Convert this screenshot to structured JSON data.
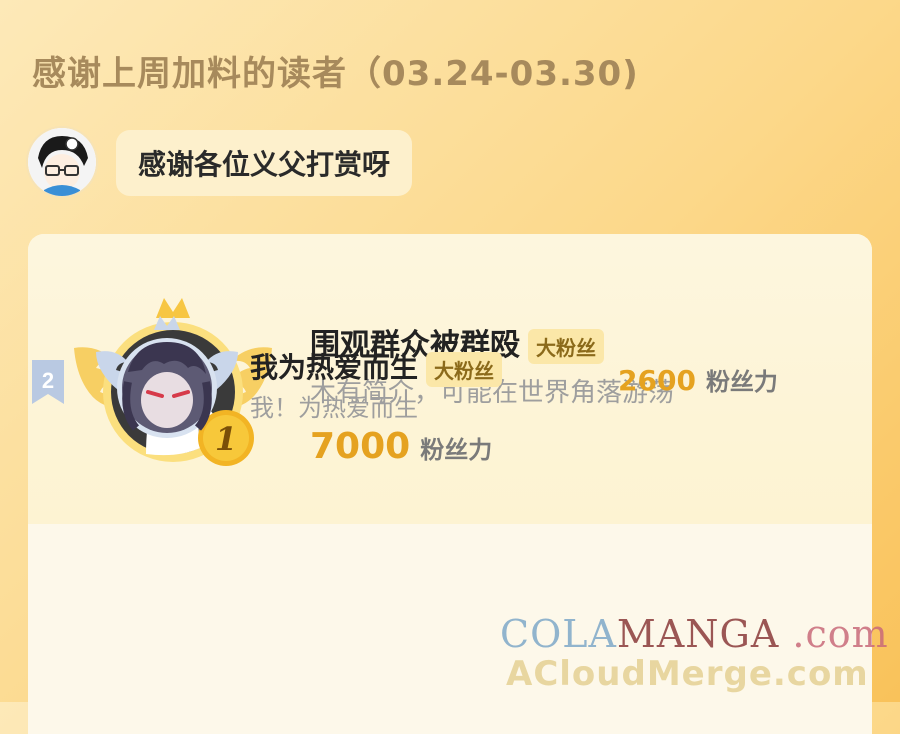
{
  "header": {
    "title": "感谢上周加料的读者（03.24-03.30)"
  },
  "host": {
    "message": "感谢各位义父打赏呀"
  },
  "ranking": [
    {
      "rank": "1",
      "name": "围观群众被群殴",
      "tag": "大粉丝",
      "description": "木有简介，可能在世界角落游荡",
      "score": "7000",
      "unit": "粉丝力"
    },
    {
      "rank": "2",
      "name": "我为热爱而生",
      "tag": "大粉丝",
      "description": "我！为热爱而生",
      "score": "2600",
      "unit": "粉丝力"
    }
  ],
  "watermark": {
    "line1_a": "COLA",
    "line1_b": "MANGA",
    "line1_c": " .com",
    "line2": "ACloudMerge.com"
  },
  "colors": {
    "gold": "#e5a220",
    "tag_bg": "#fbe7a8",
    "title": "#a78a5c"
  }
}
